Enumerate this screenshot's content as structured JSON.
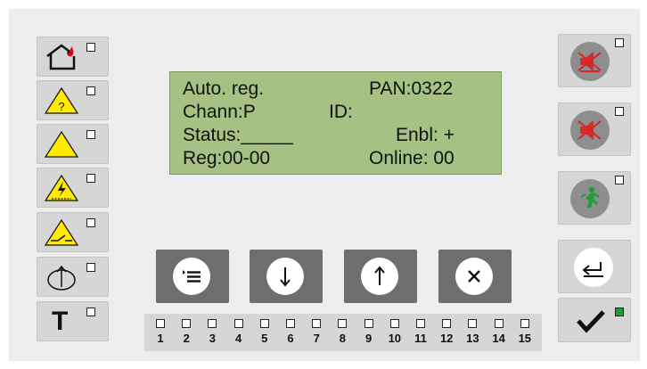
{
  "lcd": {
    "line1_left": "Auto. reg.",
    "line1_right": "PAN:0322",
    "line2_left": "Chann:P",
    "line2_mid": "ID:",
    "line3_left": "Status:_____",
    "line3_right": "Enbl: +",
    "line4_left": "Reg:00-00",
    "line4_right": "Online: 00"
  },
  "left_buttons": {
    "fire_icon": "house-fire-icon",
    "question_icon": "warning-question-icon",
    "warning_icon": "warning-icon",
    "power_icon": "warning-power-icon",
    "fault_icon": "warning-fault-icon",
    "disconnect_icon": "disconnect-icon",
    "test_label": "T"
  },
  "right_buttons": {
    "mute_icon": "speaker-mute-icon",
    "sound_off_icon": "sound-off-icon",
    "exit_icon": "emergency-exit-icon",
    "back_icon": "back-icon",
    "confirm_icon": "checkmark-icon",
    "confirm_indicator_color": "#1e9e3a"
  },
  "nav_buttons": {
    "menu_icon": "menu-icon",
    "down_icon": "arrow-down-icon",
    "up_icon": "arrow-up-icon",
    "cancel_icon": "close-icon"
  },
  "zones": [
    "1",
    "2",
    "3",
    "4",
    "5",
    "6",
    "7",
    "8",
    "9",
    "10",
    "11",
    "12",
    "13",
    "14",
    "15"
  ],
  "colors": {
    "lcd_bg": "#a7c184",
    "warning_yellow": "#ffea00",
    "fire_red": "#e0001a",
    "exit_green": "#1e9e3a"
  }
}
